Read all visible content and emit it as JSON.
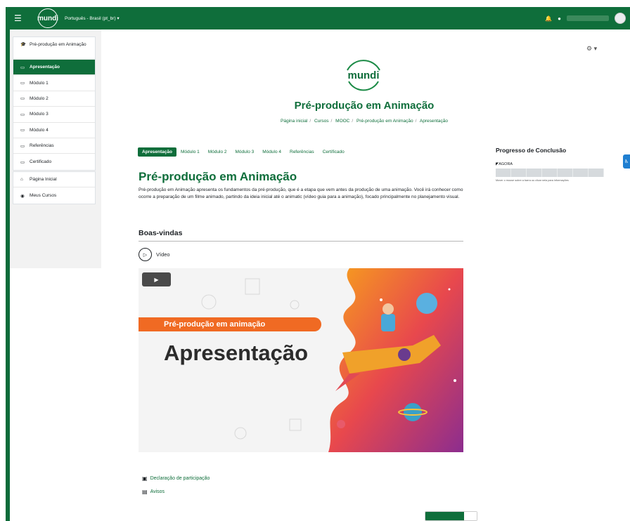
{
  "navbar": {
    "menu_icon": "hamburger-icon",
    "logo_text": "mundi",
    "language": "Português - Brasil (pt_br) ▾"
  },
  "drawer": {
    "course_items": [
      {
        "label": "Pré-produção em Animação",
        "icon": "graduation-cap-icon"
      },
      {
        "label": "Apresentação",
        "icon": "folder-icon"
      },
      {
        "label": "Módulo 1",
        "icon": "folder-icon"
      },
      {
        "label": "Módulo 2",
        "icon": "folder-icon"
      },
      {
        "label": "Módulo 3",
        "icon": "folder-icon"
      },
      {
        "label": "Módulo 4",
        "icon": "folder-icon"
      },
      {
        "label": "Referências",
        "icon": "folder-icon"
      },
      {
        "label": "Certificado",
        "icon": "folder-icon"
      }
    ],
    "site_items": [
      {
        "label": "Página Inicial",
        "icon": "home-icon"
      },
      {
        "label": "Meus Cursos",
        "icon": "dashboard-icon"
      }
    ]
  },
  "header": {
    "logo_text": "mundi",
    "title": "Pré-produção em Animação",
    "breadcrumb": [
      "Página inicial",
      "Cursos",
      "MOOC",
      "Pré-produção em Animação",
      "Apresentação"
    ]
  },
  "tabs": [
    "Apresentação",
    "Módulo 1",
    "Módulo 2",
    "Módulo 3",
    "Módulo 4",
    "Referências",
    "Certificado"
  ],
  "section": {
    "title": "Pré-produção em Animação",
    "summary": "Pré-produção em Animação apresenta os fundamentos da pré-produção, que é a etapa que vem antes da produção de uma animação. Você irá conhecer como ocorre a preparação de um filme animado, partindo da ideia inicial até o animatic (vídeo guia para a animação), focado principalmente no planejamento visual.",
    "welcome": "Boas-vindas",
    "video_label": "Vídeo"
  },
  "banner": {
    "pill_text": "Pré-produção em animação",
    "big_text": "Apresentação"
  },
  "links": [
    {
      "label": "Declaração de participação",
      "icon": "certificate-icon"
    },
    {
      "label": "Avisos",
      "icon": "forum-icon"
    }
  ],
  "progress": {
    "title": "Progresso de Conclusão",
    "now_label": "AGORA",
    "hint": "Mover o mouse sobre a barra ou clicar nela para informações"
  }
}
